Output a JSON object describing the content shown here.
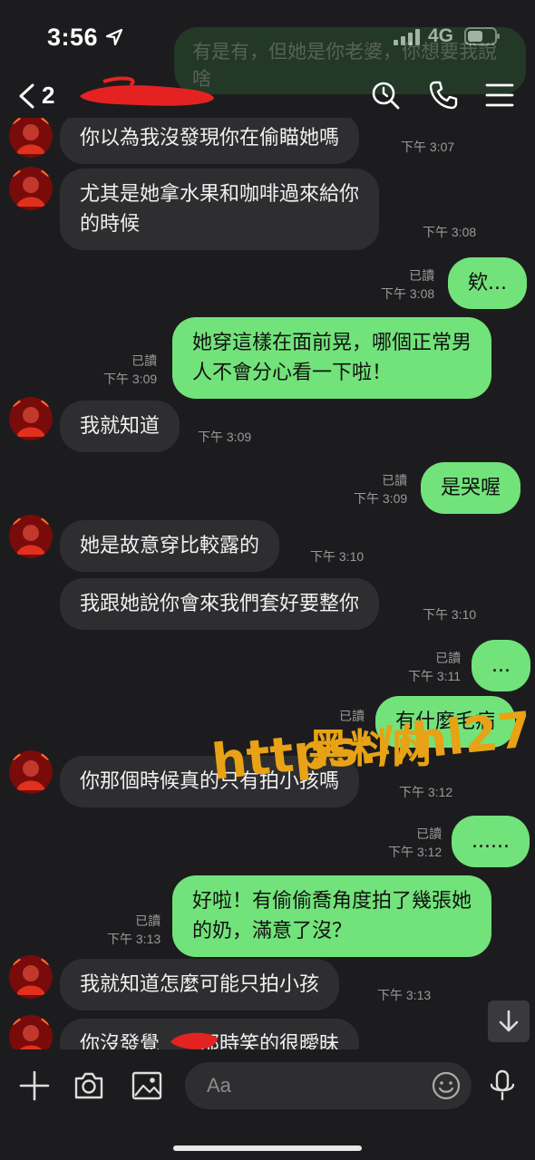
{
  "status_bar": {
    "time": "3:56",
    "network": "4G"
  },
  "ghost_bubble": {
    "text": "有是有，但她是你老婆，你想要我說啥"
  },
  "header": {
    "unread_count": "2"
  },
  "messages": [
    {
      "dir": "in",
      "text": "你以為我沒發現你在偷瞄她嗎",
      "time": "下午 3:07"
    },
    {
      "dir": "in",
      "text": "尤其是她拿水果和咖啡過來給你\n的時候",
      "time": "下午 3:08"
    },
    {
      "dir": "out",
      "text": "欸...",
      "read": "已讀",
      "time": "下午 3:08"
    },
    {
      "dir": "out",
      "text": "她穿這樣在面前晃，哪個正常男\n人不會分心看一下啦！",
      "read": "已讀",
      "time": "下午 3:09"
    },
    {
      "dir": "in",
      "text": "我就知道",
      "time": "下午 3:09"
    },
    {
      "dir": "out",
      "text": "是哭喔",
      "read": "已讀",
      "time": "下午 3:09"
    },
    {
      "dir": "in",
      "text": "她是故意穿比較露的",
      "time": "下午 3:10"
    },
    {
      "dir": "in",
      "text": "我跟她說你會來我們套好要整你",
      "time": "下午 3:10"
    },
    {
      "dir": "out",
      "text": "...",
      "read": "已讀",
      "time": "下午 3:11"
    },
    {
      "dir": "out",
      "text": "有什麼毛病",
      "read": "已讀",
      "time": ""
    },
    {
      "dir": "in",
      "text": "你那個時候真的只有拍小孩嗎",
      "time": "下午 3:12"
    },
    {
      "dir": "out",
      "text": "......",
      "read": "已讀",
      "time": "下午 3:12"
    },
    {
      "dir": "out",
      "text": "好啦！有偷偷喬角度拍了幾張她\n的奶，滿意了沒？",
      "read": "已讀",
      "time": "下午 3:13"
    },
    {
      "dir": "in",
      "text": "我就知道怎麼可能只拍小孩",
      "time": "下午 3:13"
    },
    {
      "dir": "in",
      "text": "你沒發覺　　那時笑的很曖昧",
      "time": ""
    }
  ],
  "watermark": {
    "line1": "黑料网",
    "line2": "https://hl27.co"
  },
  "input": {
    "placeholder": "Aa"
  },
  "icons": {
    "search": "search-icon",
    "call": "phone-icon",
    "menu": "menu-icon",
    "add": "plus-icon",
    "camera": "camera-icon",
    "image": "image-icon",
    "emoji": "emoji-icon",
    "mic": "mic-icon",
    "scroll": "arrow-down-icon"
  },
  "colors": {
    "background": "#1c1c1e",
    "incoming": "#2e2e30",
    "outgoing": "#72e37a",
    "watermark": "#e8a215"
  }
}
